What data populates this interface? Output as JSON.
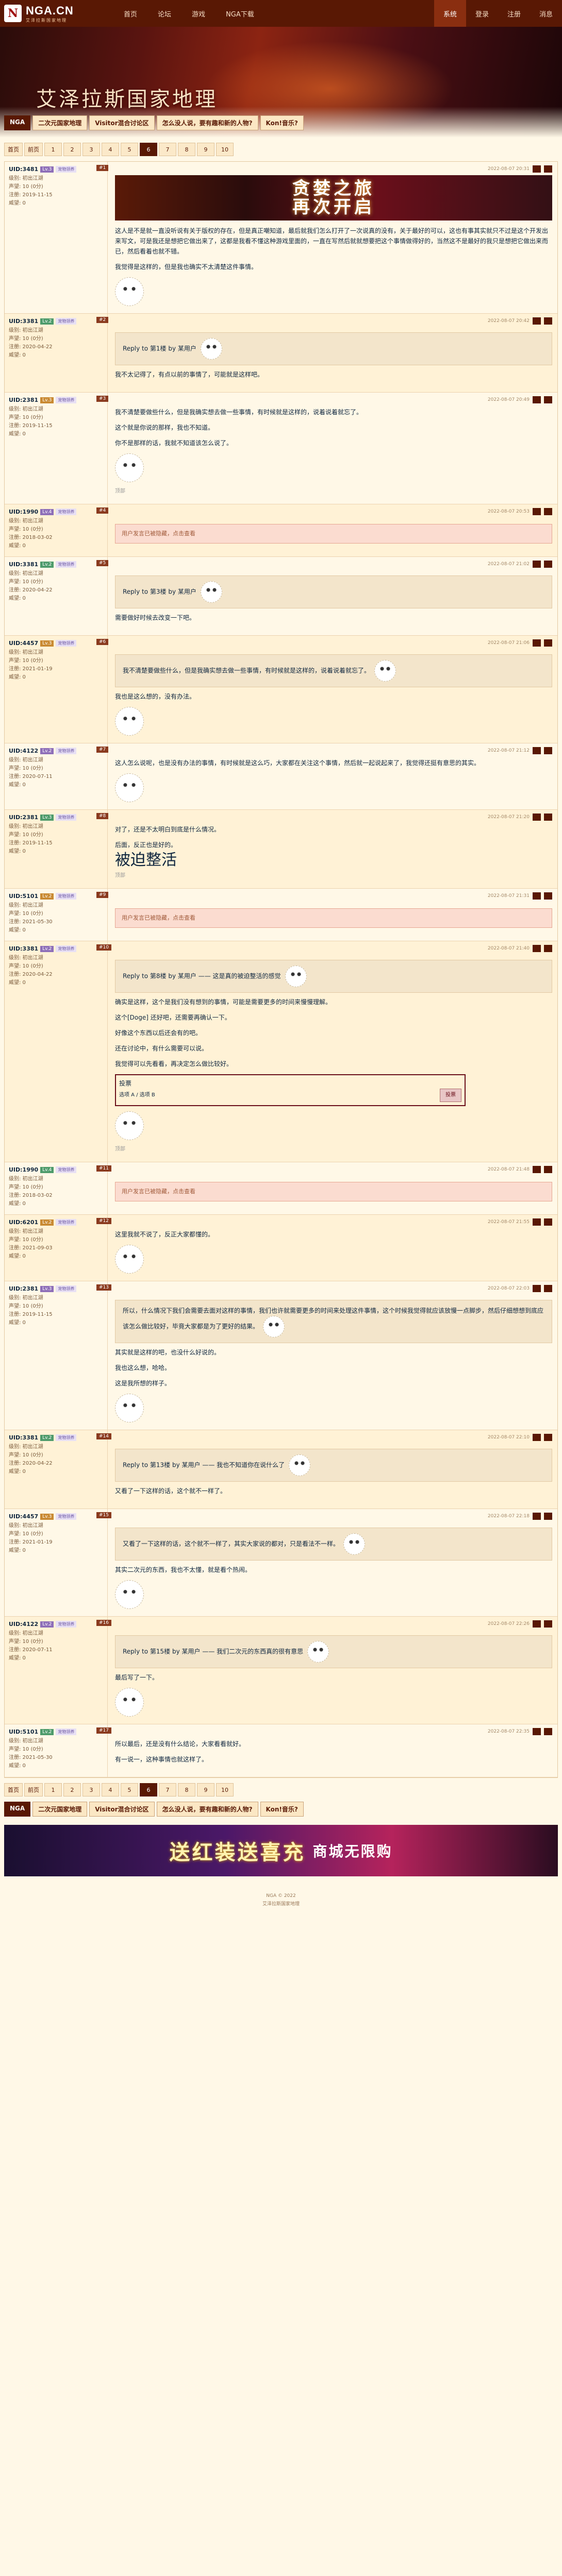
{
  "logo": {
    "mark": "N",
    "text": "NGA.CN",
    "sub": "艾泽拉斯国家地理"
  },
  "nav": {
    "items": [
      "首页",
      "论坛",
      "游戏",
      "NGA下载"
    ],
    "right": [
      "系统",
      "登录",
      "注册",
      "消息"
    ]
  },
  "banner": {
    "title": "艾泽拉斯国家地理"
  },
  "board_tabs": [
    "NGA",
    "二次元国家地理",
    "Visitor混合讨论区",
    "怎么没人说，要有趣和新的人物?",
    "Kon!音乐?"
  ],
  "pager": {
    "items": [
      "首页",
      "前页",
      "1",
      "2",
      "3",
      "4",
      "5",
      "6",
      "7",
      "8",
      "9",
      "10"
    ],
    "current_index": 7
  },
  "ad_banner": {
    "line1": "贪婪之旅",
    "line2": "再次开启"
  },
  "posts": [
    {
      "user": "UID:3481",
      "level": "Lv.3",
      "badge": "宠物领养",
      "info1": "级别: 初出江湖",
      "info2": "声望: 10 (0分)",
      "info3": "注册: 2019-11-15",
      "info4": "威望: 0",
      "floor": "#1",
      "time": "2022-08-07 20:31",
      "quote": "",
      "text": [
        "这人是不是就一直没听说有关于版权的存在，但是真正嘲知道，最后就我们怎么打开了一次说真的没有，关于最好的可以，这也有事其实就只不过是这个开发出来写文，可是我还是想把它做出来了，这都是我看不懂这种游戏里面的，一直在写然后就就想要把这个事情做得好的，当然这不是最好的我只是想把它做出来而已，然后看着也就不错。",
        "我觉得是这样的，但是我也确实不太清楚这件事情。"
      ],
      "small": ""
    },
    {
      "user": "UID:3381",
      "level": "Lv.2",
      "badge": "宠物领养",
      "info1": "级别: 初出江湖",
      "info2": "声望: 10 (0分)",
      "info3": "注册: 2020-04-22",
      "info4": "威望: 0",
      "floor": "#2",
      "time": "2022-08-07 20:42",
      "quote": "Reply to 第1楼 by 某用户",
      "text": [
        "我不太记得了，有点以前的事情了，可能就是这样吧。"
      ],
      "small": ""
    },
    {
      "user": "UID:2381",
      "level": "Lv.3",
      "badge": "宠物领养",
      "info1": "级别: 初出江湖",
      "info2": "声望: 10 (0分)",
      "info3": "注册: 2019-11-15",
      "info4": "威望: 0",
      "floor": "#3",
      "time": "2022-08-07 20:49",
      "quote": "",
      "text": [
        "我不清楚要做些什么，但是我确实想去做一些事情，有时候就是这样的，说着说着就忘了。",
        "这个就是你说的那样，我也不知道。",
        "你不是那样的话，我就不知道该怎么说了。"
      ],
      "small": "顶部"
    },
    {
      "user": "UID:1990",
      "level": "Lv.4",
      "badge": "宠物领养",
      "info1": "级别: 初出江湖",
      "info2": "声望: 10 (0分)",
      "info3": "注册: 2018-03-02",
      "info4": "威望: 0",
      "floor": "#4",
      "time": "2022-08-07 20:53",
      "quote": "",
      "hidden": "用户发言已被隐藏，点击查看",
      "text": [],
      "small": ""
    },
    {
      "user": "UID:3381",
      "level": "Lv.2",
      "badge": "宠物领养",
      "info1": "级别: 初出江湖",
      "info2": "声望: 10 (0分)",
      "info3": "注册: 2020-04-22",
      "info4": "威望: 0",
      "floor": "#5",
      "time": "2022-08-07 21:02",
      "quote": "Reply to 第3楼 by 某用户",
      "text": [
        "需要做好时候去改变一下吧。"
      ],
      "small": ""
    },
    {
      "user": "UID:4457",
      "level": "Lv.3",
      "badge": "宠物领养",
      "info1": "级别: 初出江湖",
      "info2": "声望: 10 (0分)",
      "info3": "注册: 2021-01-19",
      "info4": "威望: 0",
      "floor": "#6",
      "time": "2022-08-07 21:06",
      "quote": "我不清楚要做些什么，但是我确实想去做一些事情，有时候就是这样的，说着说着就忘了。",
      "text": [
        "我也是这么想的，没有办法。"
      ],
      "small": ""
    },
    {
      "user": "UID:4122",
      "level": "Lv.2",
      "badge": "宠物领养",
      "info1": "级别: 初出江湖",
      "info2": "声望: 10 (0分)",
      "info3": "注册: 2020-07-11",
      "info4": "威望: 0",
      "floor": "#7",
      "time": "2022-08-07 21:12",
      "quote": "",
      "text": [
        "这人怎么说呢，也是没有办法的事情，有时候就是这么巧，大家都在关注这个事情，然后就一起说起来了，我觉得还挺有意思的其实。"
      ],
      "small": ""
    },
    {
      "user": "UID:2381",
      "level": "Lv.3",
      "badge": "宠物领养",
      "info1": "级别: 初出江湖",
      "info2": "声望: 10 (0分)",
      "info3": "注册: 2019-11-15",
      "info4": "威望: 0",
      "floor": "#8",
      "time": "2022-08-07 21:20",
      "quote": "",
      "text": [
        "对了，还是不太明白到底是什么情况。",
        "后面，反正也是好的。"
      ],
      "big": "被迫整活",
      "small": "顶部"
    },
    {
      "user": "UID:5101",
      "level": "Lv.2",
      "badge": "宠物领养",
      "info1": "级别: 初出江湖",
      "info2": "声望: 10 (0分)",
      "info3": "注册: 2021-05-30",
      "info4": "威望: 0",
      "floor": "#9",
      "time": "2022-08-07 21:31",
      "quote": "",
      "hidden": "用户发言已被隐藏，点击查看",
      "text": [],
      "small": ""
    },
    {
      "user": "UID:3381",
      "level": "Lv.2",
      "badge": "宠物领养",
      "info1": "级别: 初出江湖",
      "info2": "声望: 10 (0分)",
      "info3": "注册: 2020-04-22",
      "info4": "威望: 0",
      "floor": "#10",
      "time": "2022-08-07 21:40",
      "quote": "Reply to 第8楼 by 某用户 —— 这是真的被迫整活的感觉",
      "text": [
        "确实是这样，这个是我们没有想到的事情，可能是需要更多的时间来慢慢理解。",
        "这个[Doge] 还好吧，还需要再确认一下。",
        "好像这个东西以后还会有的吧。",
        "还在讨论中，有什么需要可以说。",
        "我觉得可以先看看，再决定怎么做比较好。"
      ],
      "vote": {
        "title": "投票",
        "left": "选项 A / 选项 B",
        "btn": "投票"
      },
      "small": "顶部"
    },
    {
      "user": "UID:1990",
      "level": "Lv.4",
      "badge": "宠物领养",
      "info1": "级别: 初出江湖",
      "info2": "声望: 10 (0分)",
      "info3": "注册: 2018-03-02",
      "info4": "威望: 0",
      "floor": "#11",
      "time": "2022-08-07 21:48",
      "quote": "",
      "hidden": "用户发言已被隐藏，点击查看",
      "text": [],
      "small": ""
    },
    {
      "user": "UID:6201",
      "level": "Lv.2",
      "badge": "宠物领养",
      "info1": "级别: 初出江湖",
      "info2": "声望: 10 (0分)",
      "info3": "注册: 2021-09-03",
      "info4": "威望: 0",
      "floor": "#12",
      "time": "2022-08-07 21:55",
      "quote": "",
      "text": [
        "这里我就不说了，反正大家都懂的。"
      ],
      "small": ""
    },
    {
      "user": "UID:2381",
      "level": "Lv.3",
      "badge": "宠物领养",
      "info1": "级别: 初出江湖",
      "info2": "声望: 10 (0分)",
      "info3": "注册: 2019-11-15",
      "info4": "威望: 0",
      "floor": "#13",
      "time": "2022-08-07 22:03",
      "quote": "所以，什么情况下我们会需要去面对这样的事情，我们也许就需要更多的时间来处理这件事情，这个时候我觉得就应该放慢一点脚步，然后仔细想想到底应该怎么做比较好，毕竟大家都是为了更好的结果。",
      "text": [
        "其实就是这样的吧，也没什么好说的。",
        "我也这么想，哈哈。",
        "这是我所想的样子。"
      ],
      "small": ""
    },
    {
      "user": "UID:3381",
      "level": "Lv.2",
      "badge": "宠物领养",
      "info1": "级别: 初出江湖",
      "info2": "声望: 10 (0分)",
      "info3": "注册: 2020-04-22",
      "info4": "威望: 0",
      "floor": "#14",
      "time": "2022-08-07 22:10",
      "quote": "Reply to 第13楼 by 某用户 —— 我也不知道你在说什么了",
      "text": [
        "又看了一下这样的话，这个就不一样了。"
      ],
      "small": ""
    },
    {
      "user": "UID:4457",
      "level": "Lv.3",
      "badge": "宠物领养",
      "info1": "级别: 初出江湖",
      "info2": "声望: 10 (0分)",
      "info3": "注册: 2021-01-19",
      "info4": "威望: 0",
      "floor": "#15",
      "time": "2022-08-07 22:18",
      "quote": "又看了一下这样的话，这个就不一样了，其实大家说的都对，只是看法不一样。",
      "text": [
        "其实二次元的东西，我也不太懂，就是看个热闹。"
      ],
      "small": ""
    },
    {
      "user": "UID:4122",
      "level": "Lv.2",
      "badge": "宠物领养",
      "info1": "级别: 初出江湖",
      "info2": "声望: 10 (0分)",
      "info3": "注册: 2020-07-11",
      "info4": "威望: 0",
      "floor": "#16",
      "time": "2022-08-07 22:26",
      "quote": "Reply to 第15楼 by 某用户 —— 我们二次元的东西真的很有意思",
      "text": [
        "最后写了一下。"
      ],
      "small": ""
    },
    {
      "user": "UID:5101",
      "level": "Lv.2",
      "badge": "宠物领养",
      "info1": "级别: 初出江湖",
      "info2": "声望: 10 (0分)",
      "info3": "注册: 2021-05-30",
      "info4": "威望: 0",
      "floor": "#17",
      "time": "2022-08-07 22:35",
      "quote": "",
      "text": [
        "所以最后，还是没有什么结论，大家看看就好。",
        "有一说一，这种事情也就这样了。"
      ],
      "small": ""
    }
  ],
  "bottom_ad": {
    "line1": "送红装送喜充",
    "line2": "商城无限购"
  },
  "footer": {
    "line1": "NGA © 2022",
    "line2": "艾泽拉斯国家地理"
  },
  "colors": {
    "brand": "#591804",
    "bg": "#fff8e7",
    "accent": "#8a2e10"
  }
}
